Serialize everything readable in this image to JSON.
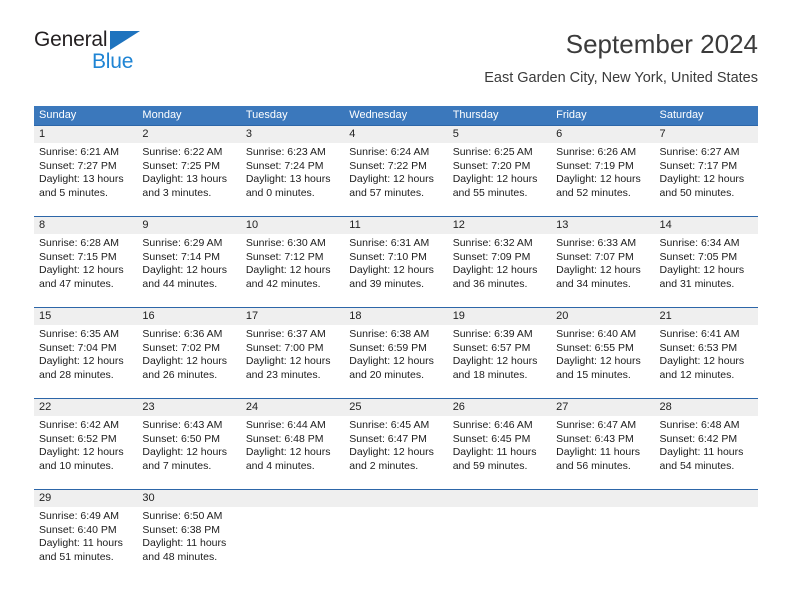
{
  "brand": {
    "name_part1": "General",
    "name_part2": "Blue",
    "triangle_icon": "triangle-icon",
    "accent_color": "#1e84d4",
    "dark_color": "#231f20"
  },
  "header": {
    "title": "September 2024",
    "subtitle": "East Garden City, New York, United States"
  },
  "calendar": {
    "header_bg": "#3b78bc",
    "row_divider": "#2d66a8",
    "daynum_band_bg": "#efefef",
    "weekdays": [
      "Sunday",
      "Monday",
      "Tuesday",
      "Wednesday",
      "Thursday",
      "Friday",
      "Saturday"
    ],
    "weeks": [
      [
        {
          "day": "1",
          "info": "Sunrise: 6:21 AM\nSunset: 7:27 PM\nDaylight: 13 hours\nand 5 minutes."
        },
        {
          "day": "2",
          "info": "Sunrise: 6:22 AM\nSunset: 7:25 PM\nDaylight: 13 hours\nand 3 minutes."
        },
        {
          "day": "3",
          "info": "Sunrise: 6:23 AM\nSunset: 7:24 PM\nDaylight: 13 hours\nand 0 minutes."
        },
        {
          "day": "4",
          "info": "Sunrise: 6:24 AM\nSunset: 7:22 PM\nDaylight: 12 hours\nand 57 minutes."
        },
        {
          "day": "5",
          "info": "Sunrise: 6:25 AM\nSunset: 7:20 PM\nDaylight: 12 hours\nand 55 minutes."
        },
        {
          "day": "6",
          "info": "Sunrise: 6:26 AM\nSunset: 7:19 PM\nDaylight: 12 hours\nand 52 minutes."
        },
        {
          "day": "7",
          "info": "Sunrise: 6:27 AM\nSunset: 7:17 PM\nDaylight: 12 hours\nand 50 minutes."
        }
      ],
      [
        {
          "day": "8",
          "info": "Sunrise: 6:28 AM\nSunset: 7:15 PM\nDaylight: 12 hours\nand 47 minutes."
        },
        {
          "day": "9",
          "info": "Sunrise: 6:29 AM\nSunset: 7:14 PM\nDaylight: 12 hours\nand 44 minutes."
        },
        {
          "day": "10",
          "info": "Sunrise: 6:30 AM\nSunset: 7:12 PM\nDaylight: 12 hours\nand 42 minutes."
        },
        {
          "day": "11",
          "info": "Sunrise: 6:31 AM\nSunset: 7:10 PM\nDaylight: 12 hours\nand 39 minutes."
        },
        {
          "day": "12",
          "info": "Sunrise: 6:32 AM\nSunset: 7:09 PM\nDaylight: 12 hours\nand 36 minutes."
        },
        {
          "day": "13",
          "info": "Sunrise: 6:33 AM\nSunset: 7:07 PM\nDaylight: 12 hours\nand 34 minutes."
        },
        {
          "day": "14",
          "info": "Sunrise: 6:34 AM\nSunset: 7:05 PM\nDaylight: 12 hours\nand 31 minutes."
        }
      ],
      [
        {
          "day": "15",
          "info": "Sunrise: 6:35 AM\nSunset: 7:04 PM\nDaylight: 12 hours\nand 28 minutes."
        },
        {
          "day": "16",
          "info": "Sunrise: 6:36 AM\nSunset: 7:02 PM\nDaylight: 12 hours\nand 26 minutes."
        },
        {
          "day": "17",
          "info": "Sunrise: 6:37 AM\nSunset: 7:00 PM\nDaylight: 12 hours\nand 23 minutes."
        },
        {
          "day": "18",
          "info": "Sunrise: 6:38 AM\nSunset: 6:59 PM\nDaylight: 12 hours\nand 20 minutes."
        },
        {
          "day": "19",
          "info": "Sunrise: 6:39 AM\nSunset: 6:57 PM\nDaylight: 12 hours\nand 18 minutes."
        },
        {
          "day": "20",
          "info": "Sunrise: 6:40 AM\nSunset: 6:55 PM\nDaylight: 12 hours\nand 15 minutes."
        },
        {
          "day": "21",
          "info": "Sunrise: 6:41 AM\nSunset: 6:53 PM\nDaylight: 12 hours\nand 12 minutes."
        }
      ],
      [
        {
          "day": "22",
          "info": "Sunrise: 6:42 AM\nSunset: 6:52 PM\nDaylight: 12 hours\nand 10 minutes."
        },
        {
          "day": "23",
          "info": "Sunrise: 6:43 AM\nSunset: 6:50 PM\nDaylight: 12 hours\nand 7 minutes."
        },
        {
          "day": "24",
          "info": "Sunrise: 6:44 AM\nSunset: 6:48 PM\nDaylight: 12 hours\nand 4 minutes."
        },
        {
          "day": "25",
          "info": "Sunrise: 6:45 AM\nSunset: 6:47 PM\nDaylight: 12 hours\nand 2 minutes."
        },
        {
          "day": "26",
          "info": "Sunrise: 6:46 AM\nSunset: 6:45 PM\nDaylight: 11 hours\nand 59 minutes."
        },
        {
          "day": "27",
          "info": "Sunrise: 6:47 AM\nSunset: 6:43 PM\nDaylight: 11 hours\nand 56 minutes."
        },
        {
          "day": "28",
          "info": "Sunrise: 6:48 AM\nSunset: 6:42 PM\nDaylight: 11 hours\nand 54 minutes."
        }
      ],
      [
        {
          "day": "29",
          "info": "Sunrise: 6:49 AM\nSunset: 6:40 PM\nDaylight: 11 hours\nand 51 minutes."
        },
        {
          "day": "30",
          "info": "Sunrise: 6:50 AM\nSunset: 6:38 PM\nDaylight: 11 hours\nand 48 minutes."
        },
        {
          "day": "",
          "info": ""
        },
        {
          "day": "",
          "info": ""
        },
        {
          "day": "",
          "info": ""
        },
        {
          "day": "",
          "info": ""
        },
        {
          "day": "",
          "info": ""
        }
      ]
    ]
  }
}
